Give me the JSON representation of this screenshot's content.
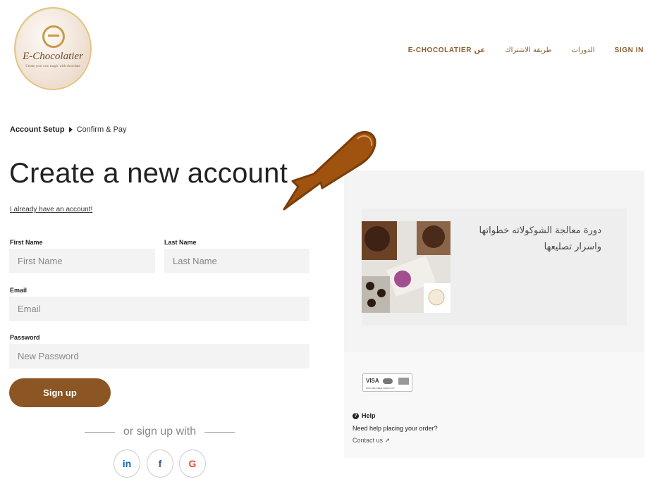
{
  "logo": {
    "name": "E-Chocolatier",
    "tagline": "Create your own magic with chocolate"
  },
  "nav": {
    "about": "E-CHOCOLATIER عن",
    "subscription": "طريقة الاشتراك",
    "courses": "الدورات",
    "signin": "SIGN IN"
  },
  "breadcrumb": {
    "current": "Account Setup",
    "next": "Confirm & Pay"
  },
  "page_title": "Create a new account",
  "have_account": "I already have an account!",
  "form": {
    "first_name_label": "First Name",
    "first_name_placeholder": "First Name",
    "last_name_label": "Last Name",
    "last_name_placeholder": "Last Name",
    "email_label": "Email",
    "email_placeholder": "Email",
    "password_label": "Password",
    "password_placeholder": "New Password",
    "submit": "Sign up"
  },
  "or_signup": "or sign up with",
  "social": {
    "linkedin": "in",
    "facebook": "f",
    "google": "G"
  },
  "course": {
    "title": "دورة معالجة الشوكولاته خطواتها واسرار تصليعها"
  },
  "payment": {
    "brands": "VISA",
    "secure": "100% SECURED CHECKOUT"
  },
  "help": {
    "title": "Help",
    "question": "Need help placing your order?",
    "contact": "Contact us"
  },
  "colors": {
    "accent": "#8b5524",
    "nav": "#8b5a2b",
    "arrow": "#a0520f"
  }
}
